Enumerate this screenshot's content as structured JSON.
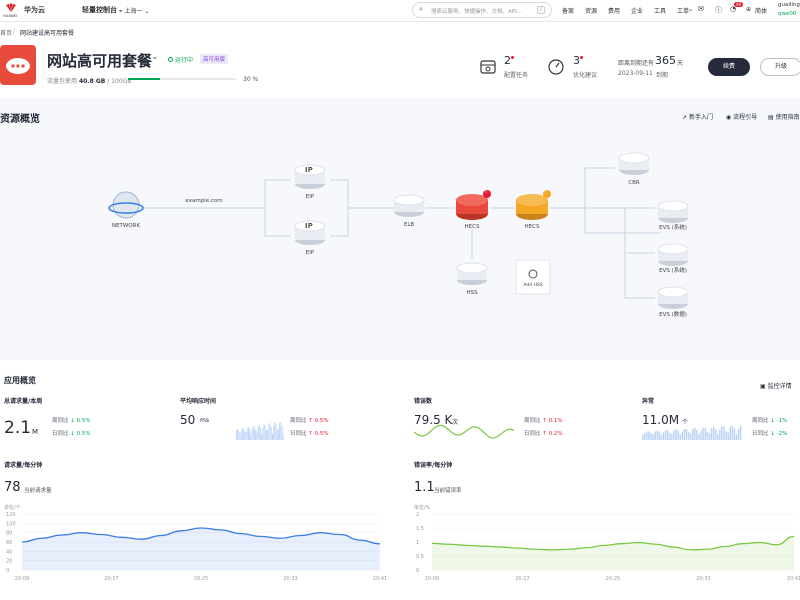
{
  "topbar": {
    "brand": "华为云",
    "brand_small": "HUAWEI",
    "console": "轻量控制台",
    "region": "上海一",
    "search_placeholder": "搜索云服务、快捷操作、文档、API...",
    "search_shortcut": "/",
    "links": [
      "备案",
      "资源",
      "费用",
      "企业",
      "工具",
      "工单"
    ],
    "lang": "简体",
    "user_name": "guailing",
    "user_sub": "qwe00",
    "badge": "99"
  },
  "breadcrumb": {
    "home": "首页",
    "sep": "/",
    "current": "网站建设高可用套餐"
  },
  "header": {
    "title": "网站高可用套餐",
    "status": "运行中",
    "tag": "高可用版",
    "traffic_label": "流量包使用",
    "traffic_value": "40.8 GB",
    "traffic_total": "/ 100GB",
    "traffic_percent": "30 %",
    "traffic_fraction": 0.3,
    "tasks_count": "2",
    "tasks_label": "配置任务",
    "optimize_count": "3",
    "optimize_label": "优化建议",
    "expire_label": "距离到期还有",
    "expire_days": "365",
    "expire_unit": "天",
    "expire_date": "2023-09-11",
    "expire_suffix": "到期",
    "renew": "续费",
    "upgrade": "升级"
  },
  "resource": {
    "title": "资源概览",
    "links": [
      "新手入门",
      "流程引导",
      "使用指南"
    ],
    "network": "NETWORK",
    "domain": "example.com",
    "eip1": "EIP",
    "eip2": "EIP",
    "elb": "ELB",
    "hecs1": "HECS",
    "hecs2": "HECS",
    "hss": "HSS",
    "add_hss": "Add HSS",
    "cbr": "CBR",
    "evs1": "EVS (系统)",
    "evs2": "EVS (系统)",
    "evs3": "EVS (数据)",
    "ip_text": "IP",
    "badge1": "!",
    "badge2": "!",
    "colors": {
      "red": "#e84a3c",
      "orange": "#f5a623"
    }
  },
  "app": {
    "title": "应用概览",
    "monitor": "监控详情",
    "cards": [
      {
        "label": "总请求量/本周",
        "value": "2.1",
        "unit": "M",
        "week": "周同比",
        "week_val": "0.5%",
        "day": "日同比",
        "day_val": "0.5%",
        "trend": "down"
      },
      {
        "label": "平均响应时间",
        "value": "50",
        "unit": "ms",
        "week": "周同比",
        "week_val": "0.5%",
        "day": "日同比",
        "day_val": "0.5%",
        "trend": "up"
      },
      {
        "label": "错误数",
        "value": "79.5 K",
        "unit": "次",
        "week": "周同比",
        "week_val": "0.1%",
        "day": "日同比",
        "day_val": "0.2%",
        "trend": "up"
      },
      {
        "label": "异常",
        "value": "11.0M",
        "unit": "个",
        "week": "周同比",
        "week_val": "-1%",
        "day": "日同比",
        "day_val": "-2%",
        "trend": "down"
      }
    ]
  },
  "charts": {
    "left": {
      "title": "请求量/每分钟",
      "value": "78",
      "sub": "当前请求量",
      "unit_label": "单位/个"
    },
    "right": {
      "title": "错误率/每分钟",
      "value": "1.1",
      "sub": "当前错误率",
      "unit_label": "单位/%"
    }
  },
  "chart_data": [
    {
      "type": "area",
      "title": "请求量/每分钟",
      "ylabel": "单位/个",
      "x": [
        "20:09",
        "20:17",
        "20:25",
        "20:33",
        "20:41"
      ],
      "ylim": [
        0,
        120
      ],
      "yticks": [
        0,
        20,
        40,
        60,
        80,
        100,
        120
      ],
      "values": [
        60,
        68,
        75,
        80,
        76,
        70,
        66,
        74,
        84,
        90,
        86,
        78,
        72,
        68,
        74,
        80,
        76,
        64,
        56
      ],
      "color": "#3b7ce8"
    },
    {
      "type": "area",
      "title": "错误率/每分钟",
      "ylabel": "单位/%",
      "x": [
        "20:09",
        "20:17",
        "20:25",
        "20:33",
        "20:41"
      ],
      "ylim": [
        0,
        2
      ],
      "yticks": [
        0,
        0.5,
        1,
        1.5,
        2
      ],
      "values": [
        0.95,
        0.92,
        0.88,
        0.85,
        0.82,
        0.78,
        0.74,
        0.72,
        0.74,
        0.8,
        0.88,
        0.94,
        0.98,
        0.92,
        0.82,
        0.72,
        0.74,
        0.84,
        0.94,
        0.98,
        0.9,
        1.2
      ],
      "color": "#7ac943"
    }
  ]
}
